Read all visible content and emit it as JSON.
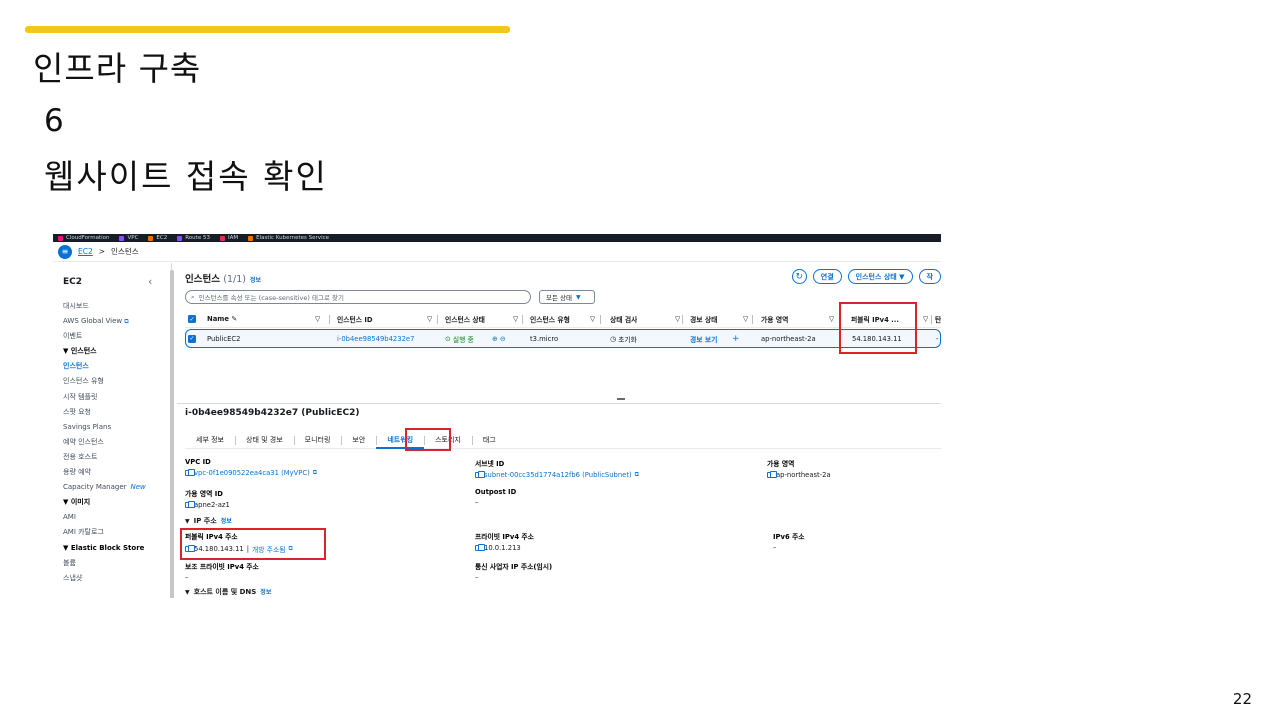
{
  "slide": {
    "title": "인프라 구축",
    "step_number": "6",
    "step_title": "웹사이트 접속 확인",
    "page_number": "22",
    "accent_color": "#f5c518"
  },
  "console": {
    "topnav_services": [
      "CloudFormation",
      "VPC",
      "EC2",
      "Route 53",
      "IAM",
      "Elastic Kubernetes Service"
    ],
    "breadcrumb": {
      "service": "EC2",
      "separator": ">",
      "current": "인스턴스"
    },
    "sidebar": {
      "header": "EC2",
      "items": [
        {
          "label": "대시보드"
        },
        {
          "label": "AWS Global View"
        },
        {
          "label": "이벤트"
        },
        {
          "label": "▼ 인스턴스"
        },
        {
          "label": "인스턴스"
        },
        {
          "label": "인스턴스 유형"
        },
        {
          "label": "시작 템플릿"
        },
        {
          "label": "스팟 요청"
        },
        {
          "label": "Savings Plans"
        },
        {
          "label": "예약 인스턴스"
        },
        {
          "label": "전용 호스트"
        },
        {
          "label": "용량 예약"
        },
        {
          "label": "Capacity Manager",
          "badge": "New"
        },
        {
          "label": "▼ 이미지"
        },
        {
          "label": "AMI"
        },
        {
          "label": "AMI 카탈로그"
        },
        {
          "label": "▼ Elastic Block Store"
        },
        {
          "label": "볼륨"
        },
        {
          "label": "스냅샷"
        }
      ]
    },
    "instances": {
      "title": "인스턴스",
      "count": "(1/1)",
      "info": "정보",
      "connect_button": "연결",
      "state_button": "인스턴스 상태 ▼",
      "more_button": "작",
      "search_placeholder": "인스턴스를 속성 또는 (case-sensitive) 태그로 찾기",
      "state_filter": "모든 상태",
      "columns": [
        "Name",
        "인스턴스 ID",
        "인스턴스 상태",
        "인스턴스 유형",
        "상태 검사",
        "경보 상태",
        "가용 영역",
        "퍼블릭 IPv4 ...",
        "탄"
      ],
      "row": {
        "name": "PublicEC2",
        "instance_id": "i-0b4ee98549b4232e7",
        "state": "실행 중",
        "type": "t3.micro",
        "status_check": "초기화",
        "alarm": "경보 보기",
        "az": "ap-northeast-2a",
        "public_ip": "54.180.143.11",
        "extra": "-"
      }
    },
    "details": {
      "title": "i-0b4ee98549b4232e7 (PublicEC2)",
      "tabs": [
        "세부 정보",
        "상태 및 경보",
        "모니터링",
        "보안",
        "네트워킹",
        "스토리지",
        "태그"
      ],
      "active_tab": "네트워킹",
      "vpc_label": "VPC ID",
      "vpc_value": "vpc-0f1e090522ea4ca31 (MyVPC)",
      "subnet_label": "서브넷 ID",
      "subnet_value": "subnet-00cc35d1774a12fb6 (PublicSubnet)",
      "az_label": "가용 영역",
      "az_value": "ap-northeast-2a",
      "azid_label": "가용 영역 ID",
      "azid_value": "apne2-az1",
      "outpost_label": "Outpost ID",
      "outpost_value": "–",
      "ip_section": "IP 주소",
      "ip_info": "정보",
      "public_ip_label": "퍼블릭 IPv4 주소",
      "public_ip_value": "54.180.143.11",
      "open_address": "개방 주소됨",
      "private_ip_label": "프라이빗 IPv4 주소",
      "private_ip_value": "10.0.1.213",
      "ipv6_label": "IPv6 주소",
      "ipv6_value": "–",
      "secondary_label": "보조 프라이빗 IPv4 주소",
      "secondary_value": "–",
      "carrier_label": "통신 사업자 IP 주소(임시)",
      "carrier_value": "–",
      "host_section": "호스트 이름 및 DNS",
      "host_info": "정보"
    }
  }
}
